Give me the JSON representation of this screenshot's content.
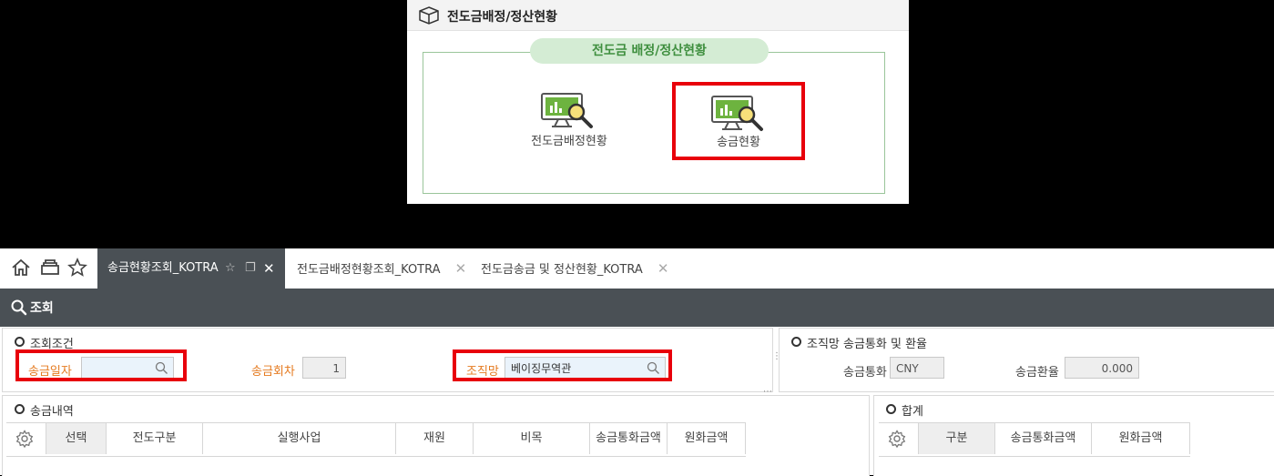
{
  "top_panel": {
    "title": "전도금배정/정산현황",
    "group_label": "전도금 배정/정산현황",
    "tiles": [
      {
        "label": "전도금배정현황",
        "icon": "monitor-chart-magnifier-icon",
        "highlighted": false
      },
      {
        "label": "송금현황",
        "icon": "monitor-chart-magnifier-icon",
        "highlighted": true
      }
    ]
  },
  "tabs": [
    {
      "label": "송금현황조회_KOTRA",
      "active": true
    },
    {
      "label": "전도금배정현황조회_KOTRA",
      "active": false
    },
    {
      "label": "전도금송금 및 정산현황_KOTRA",
      "active": false
    }
  ],
  "tab_close_glyph": "✕",
  "search_bar": {
    "label": "조회"
  },
  "conditions": {
    "title": "조회조건",
    "remit_date": {
      "label": "송금일자",
      "value": "",
      "placeholder": ""
    },
    "remit_round": {
      "label": "송금회차",
      "value": "1"
    },
    "office": {
      "label": "조직망",
      "value": "베이징무역관"
    }
  },
  "rate_section": {
    "title": "조직망 송금통화 및 환율",
    "currency": {
      "label": "송금통화",
      "value": "CNY"
    },
    "rate": {
      "label": "송금환율",
      "value": "0.000"
    }
  },
  "history": {
    "title": "송금내역",
    "columns": [
      "선택",
      "전도구분",
      "실행사업",
      "재원",
      "비목",
      "송금통화금액",
      "원화금액"
    ]
  },
  "summary": {
    "title": "합계",
    "columns": [
      "구분",
      "송금통화금액",
      "원화금액"
    ]
  },
  "colors": {
    "highlight": "#e8000b",
    "label_orange": "#e57a1f",
    "dark_bar": "#4a5055",
    "pill_green": "#d4ecd4"
  }
}
